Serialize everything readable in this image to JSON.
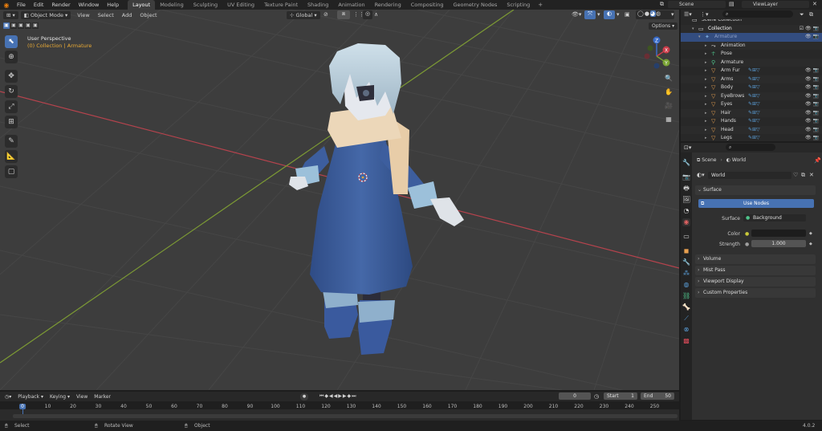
{
  "topbar": {
    "menus": [
      "File",
      "Edit",
      "Render",
      "Window",
      "Help"
    ],
    "workspaces": [
      "Layout",
      "Modeling",
      "Sculpting",
      "UV Editing",
      "Texture Paint",
      "Shading",
      "Animation",
      "Rendering",
      "Compositing",
      "Geometry Nodes",
      "Scripting"
    ],
    "active_workspace": "Layout",
    "scene": "Scene",
    "view_layer": "ViewLayer"
  },
  "viewport": {
    "mode": "Object Mode",
    "menus": [
      "View",
      "Select",
      "Add",
      "Object"
    ],
    "transform_orientation": "Global",
    "view_name": "User Perspective",
    "collection_info": "(0) Collection | Armature",
    "options_label": "Options",
    "gizmo_labels": {
      "x": "X",
      "y": "Y",
      "z": "Z"
    }
  },
  "outliner": {
    "search_placeholder": "",
    "rows": [
      {
        "label": "Scene Collection",
        "indent": 0,
        "icon": "collection-icon",
        "color": "#d6d6d6"
      },
      {
        "label": "Collection",
        "indent": 1,
        "icon": "collection-icon",
        "color": "#ffffff"
      },
      {
        "label": "Armature",
        "indent": 2,
        "icon": "armature-icon",
        "color": "#8ea0c8"
      },
      {
        "label": "Animation",
        "indent": 3,
        "icon": "animation-icon",
        "color": "#d6d6d6"
      },
      {
        "label": "Pose",
        "indent": 3,
        "icon": "pose-icon",
        "color": "#d6d6d6"
      },
      {
        "label": "Armature",
        "indent": 3,
        "icon": "armature-data-icon",
        "color": "#d6d6d6"
      },
      {
        "label": "Arm Fur",
        "indent": 3,
        "icon": "mesh-icon",
        "color": "#d6d6d6"
      },
      {
        "label": "Arms",
        "indent": 3,
        "icon": "mesh-icon",
        "color": "#d6d6d6"
      },
      {
        "label": "Body",
        "indent": 3,
        "icon": "mesh-icon",
        "color": "#d6d6d6"
      },
      {
        "label": "EyeBrows",
        "indent": 3,
        "icon": "mesh-icon",
        "color": "#d6d6d6"
      },
      {
        "label": "Eyes",
        "indent": 3,
        "icon": "mesh-icon",
        "color": "#d6d6d6"
      },
      {
        "label": "Hair",
        "indent": 3,
        "icon": "mesh-icon",
        "color": "#d6d6d6"
      },
      {
        "label": "Hands",
        "indent": 3,
        "icon": "mesh-icon",
        "color": "#d6d6d6"
      },
      {
        "label": "Head",
        "indent": 3,
        "icon": "mesh-icon",
        "color": "#d6d6d6"
      },
      {
        "label": "Legs",
        "indent": 3,
        "icon": "mesh-icon",
        "color": "#d6d6d6"
      }
    ]
  },
  "properties": {
    "breadcrumb_scene": "Scene",
    "breadcrumb_world": "World",
    "world_name": "World",
    "surface_panel": "Surface",
    "use_nodes_label": "Use Nodes",
    "surface_label": "Surface",
    "surface_value": "Background",
    "color_label": "Color",
    "strength_label": "Strength",
    "strength_value": "1.000",
    "collapsed_panels": [
      "Volume",
      "Mist Pass",
      "Viewport Display",
      "Custom Properties"
    ]
  },
  "timeline": {
    "menus": [
      "Playback",
      "Keying",
      "View",
      "Marker"
    ],
    "current_frame": "0",
    "start_label": "Start",
    "start_value": "1",
    "end_label": "End",
    "end_value": "50",
    "ruler": [
      "0",
      "10",
      "20",
      "30",
      "40",
      "50",
      "60",
      "70",
      "80",
      "90",
      "100",
      "110",
      "120",
      "130",
      "140",
      "150",
      "160",
      "170",
      "180",
      "190",
      "200",
      "210",
      "220",
      "230",
      "240",
      "250"
    ],
    "playhead_frame": "0"
  },
  "statusbar": {
    "select": "Select",
    "rotate": "Rotate View",
    "object": "Object",
    "version": "4.0.2"
  },
  "colors": {
    "accent": "#4772b3",
    "axis_x": "#c74a52",
    "axis_y": "#86a33a",
    "coat": "#3d5e9e",
    "hair": "#b8ccda",
    "scarf": "#ebd6b8"
  }
}
